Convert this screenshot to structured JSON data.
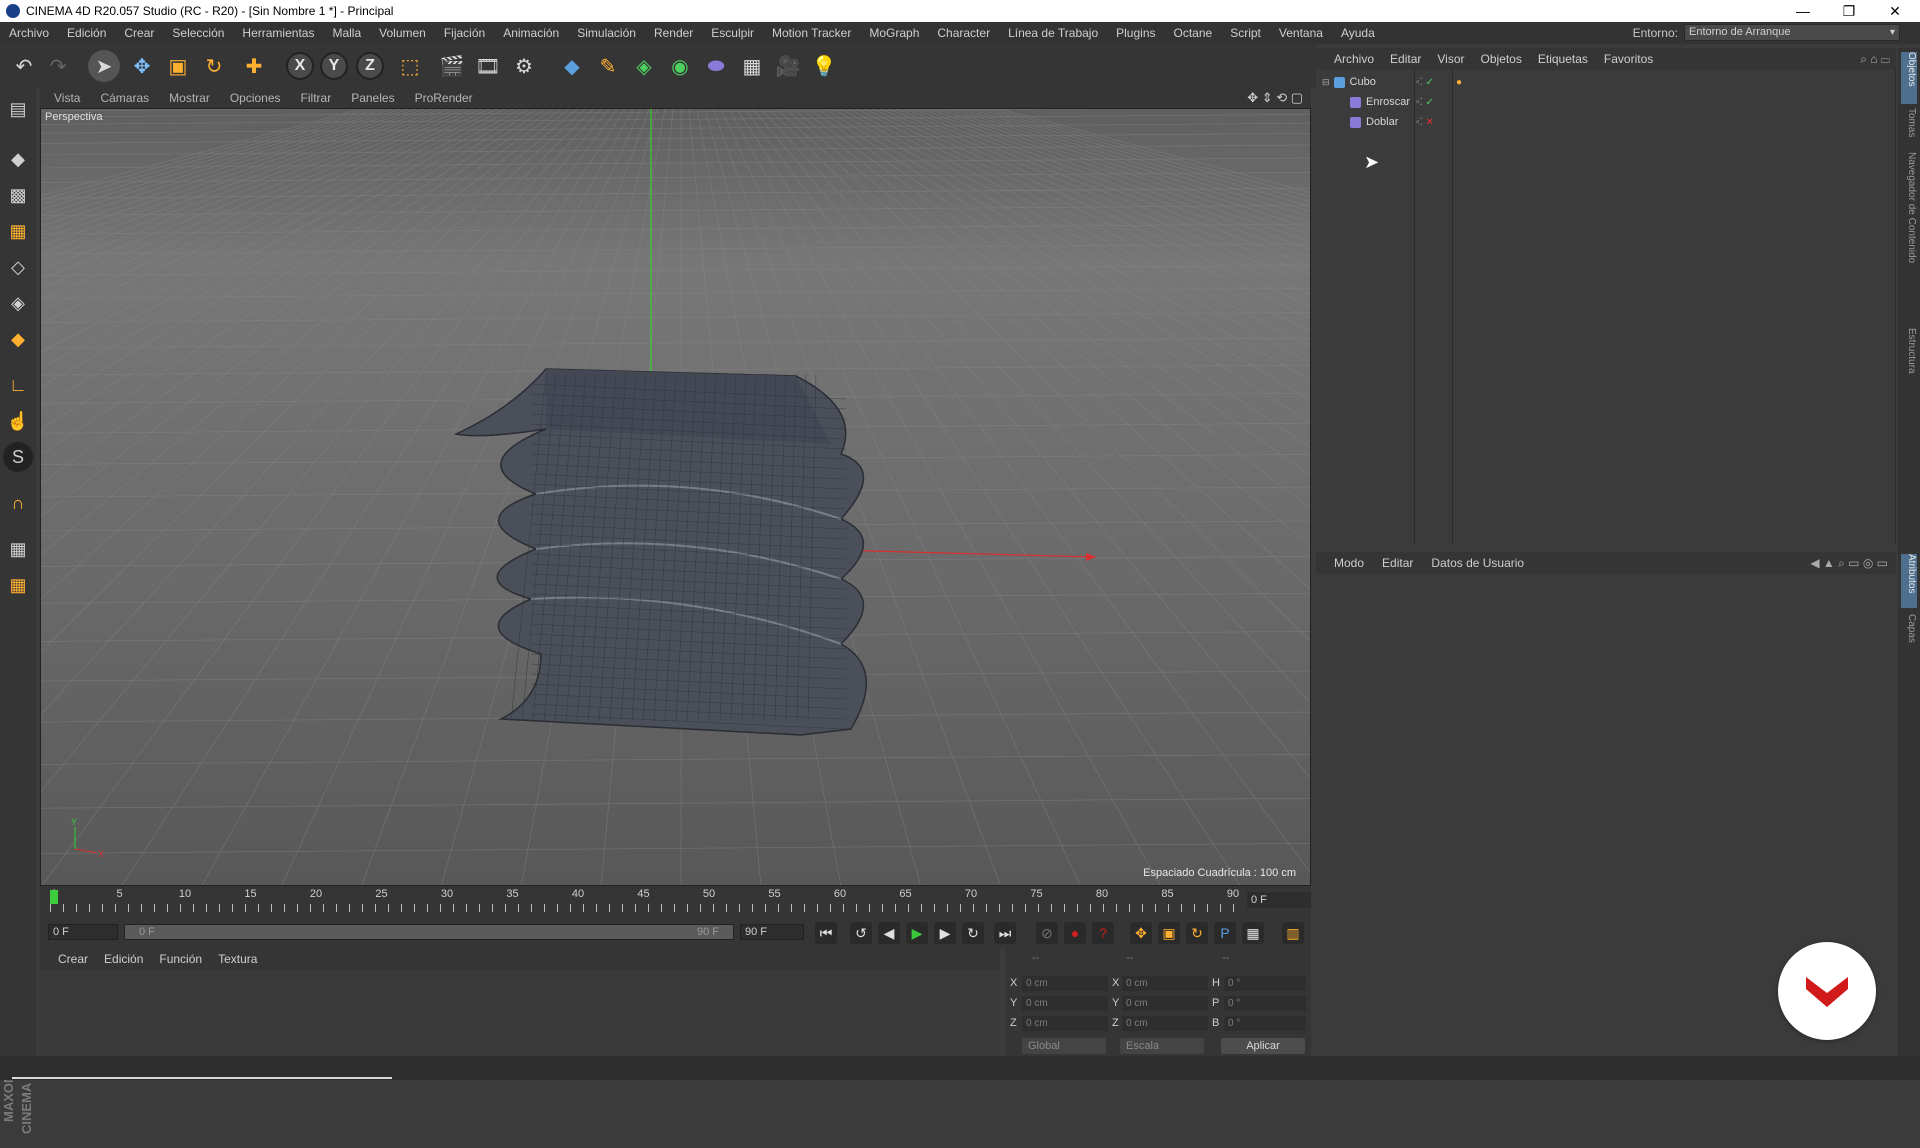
{
  "title_bar": {
    "title": "CINEMA 4D R20.057 Studio (RC - R20) - [Sin Nombre 1 *] - Principal",
    "minimize": "—",
    "restore": "❐",
    "close": "✕"
  },
  "menubar": {
    "items": [
      "Archivo",
      "Edición",
      "Crear",
      "Selección",
      "Herramientas",
      "Malla",
      "Volumen",
      "Fijación",
      "Animación",
      "Simulación",
      "Render",
      "Esculpir",
      "Motion Tracker",
      "MoGraph",
      "Character",
      "Línea de Trabajo",
      "Plugins",
      "Octane",
      "Script",
      "Ventana",
      "Ayuda"
    ],
    "env_label": "Entorno:",
    "env_value": "Entorno de Arranque"
  },
  "toolbar": {
    "undo_icon": "undo-icon",
    "x_label": "X",
    "y_label": "Y",
    "z_label": "Z"
  },
  "viewport": {
    "menu": [
      "Vista",
      "Cámaras",
      "Mostrar",
      "Opciones",
      "Filtrar",
      "Paneles",
      "ProRender"
    ],
    "camera_label": "Perspectiva",
    "grid_spacing": "Espaciado Cuadrícula : 100 cm",
    "axis_y": "Y",
    "axis_x": "X"
  },
  "timeline": {
    "ticks": [
      "0",
      "5",
      "10",
      "15",
      "20",
      "25",
      "30",
      "35",
      "40",
      "45",
      "50",
      "55",
      "60",
      "65",
      "70",
      "75",
      "80",
      "85",
      "90"
    ],
    "current_frame": "0 F"
  },
  "transport": {
    "start_field": "0 F",
    "range_start": "0 F",
    "range_end": "90 F",
    "end_field": "90 F"
  },
  "material_manager": {
    "menu": [
      "Crear",
      "Edición",
      "Función",
      "Textura"
    ]
  },
  "coordinates": {
    "header": [
      "--",
      "--",
      "--"
    ],
    "rows": [
      {
        "axis": "X",
        "pos": "0 cm",
        "axis2": "X",
        "size": "0 cm",
        "rot_label": "H",
        "rot": "0 °"
      },
      {
        "axis": "Y",
        "pos": "0 cm",
        "axis2": "Y",
        "size": "0 cm",
        "rot_label": "P",
        "rot": "0 °"
      },
      {
        "axis": "Z",
        "pos": "0 cm",
        "axis2": "Z",
        "size": "0 cm",
        "rot_label": "B",
        "rot": "0 °"
      }
    ],
    "mode_global": "Global",
    "mode_scale": "Escala",
    "apply_label": "Aplicar"
  },
  "object_manager": {
    "menu": [
      "Archivo",
      "Editar",
      "Visor",
      "Objetos",
      "Etiquetas",
      "Favoritos"
    ],
    "objects": [
      {
        "name": "Cubo",
        "color": "#5aa0e0"
      },
      {
        "name": "Enroscar",
        "color": "#8a7ad8"
      },
      {
        "name": "Doblar",
        "color": "#8a7ad8"
      }
    ]
  },
  "attributes_manager": {
    "menu": [
      "Modo",
      "Editar",
      "Datos de Usuario"
    ]
  },
  "right_tabs": [
    "Objetos",
    "Tomas",
    "Navegador de Contenido",
    "Estructura",
    "Atributos",
    "Capas"
  ],
  "branding": {
    "logo_text": "MAXON CINEMA 4D"
  },
  "colors": {
    "accent": "#5aa0e0",
    "badge": "#d11a1a",
    "play": "#3cc83c",
    "record": "#d02020"
  }
}
